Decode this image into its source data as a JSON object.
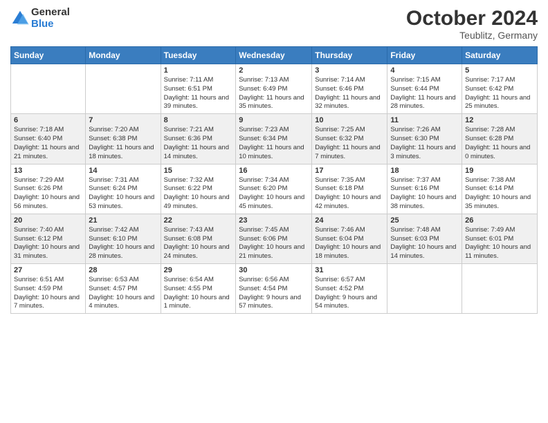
{
  "logo": {
    "general": "General",
    "blue": "Blue"
  },
  "title": "October 2024",
  "subtitle": "Teublitz, Germany",
  "days_header": [
    "Sunday",
    "Monday",
    "Tuesday",
    "Wednesday",
    "Thursday",
    "Friday",
    "Saturday"
  ],
  "weeks": [
    [
      {
        "day": "",
        "info": ""
      },
      {
        "day": "",
        "info": ""
      },
      {
        "day": "1",
        "info": "Sunrise: 7:11 AM\nSunset: 6:51 PM\nDaylight: 11 hours and 39 minutes."
      },
      {
        "day": "2",
        "info": "Sunrise: 7:13 AM\nSunset: 6:49 PM\nDaylight: 11 hours and 35 minutes."
      },
      {
        "day": "3",
        "info": "Sunrise: 7:14 AM\nSunset: 6:46 PM\nDaylight: 11 hours and 32 minutes."
      },
      {
        "day": "4",
        "info": "Sunrise: 7:15 AM\nSunset: 6:44 PM\nDaylight: 11 hours and 28 minutes."
      },
      {
        "day": "5",
        "info": "Sunrise: 7:17 AM\nSunset: 6:42 PM\nDaylight: 11 hours and 25 minutes."
      }
    ],
    [
      {
        "day": "6",
        "info": "Sunrise: 7:18 AM\nSunset: 6:40 PM\nDaylight: 11 hours and 21 minutes."
      },
      {
        "day": "7",
        "info": "Sunrise: 7:20 AM\nSunset: 6:38 PM\nDaylight: 11 hours and 18 minutes."
      },
      {
        "day": "8",
        "info": "Sunrise: 7:21 AM\nSunset: 6:36 PM\nDaylight: 11 hours and 14 minutes."
      },
      {
        "day": "9",
        "info": "Sunrise: 7:23 AM\nSunset: 6:34 PM\nDaylight: 11 hours and 10 minutes."
      },
      {
        "day": "10",
        "info": "Sunrise: 7:25 AM\nSunset: 6:32 PM\nDaylight: 11 hours and 7 minutes."
      },
      {
        "day": "11",
        "info": "Sunrise: 7:26 AM\nSunset: 6:30 PM\nDaylight: 11 hours and 3 minutes."
      },
      {
        "day": "12",
        "info": "Sunrise: 7:28 AM\nSunset: 6:28 PM\nDaylight: 11 hours and 0 minutes."
      }
    ],
    [
      {
        "day": "13",
        "info": "Sunrise: 7:29 AM\nSunset: 6:26 PM\nDaylight: 10 hours and 56 minutes."
      },
      {
        "day": "14",
        "info": "Sunrise: 7:31 AM\nSunset: 6:24 PM\nDaylight: 10 hours and 53 minutes."
      },
      {
        "day": "15",
        "info": "Sunrise: 7:32 AM\nSunset: 6:22 PM\nDaylight: 10 hours and 49 minutes."
      },
      {
        "day": "16",
        "info": "Sunrise: 7:34 AM\nSunset: 6:20 PM\nDaylight: 10 hours and 45 minutes."
      },
      {
        "day": "17",
        "info": "Sunrise: 7:35 AM\nSunset: 6:18 PM\nDaylight: 10 hours and 42 minutes."
      },
      {
        "day": "18",
        "info": "Sunrise: 7:37 AM\nSunset: 6:16 PM\nDaylight: 10 hours and 38 minutes."
      },
      {
        "day": "19",
        "info": "Sunrise: 7:38 AM\nSunset: 6:14 PM\nDaylight: 10 hours and 35 minutes."
      }
    ],
    [
      {
        "day": "20",
        "info": "Sunrise: 7:40 AM\nSunset: 6:12 PM\nDaylight: 10 hours and 31 minutes."
      },
      {
        "day": "21",
        "info": "Sunrise: 7:42 AM\nSunset: 6:10 PM\nDaylight: 10 hours and 28 minutes."
      },
      {
        "day": "22",
        "info": "Sunrise: 7:43 AM\nSunset: 6:08 PM\nDaylight: 10 hours and 24 minutes."
      },
      {
        "day": "23",
        "info": "Sunrise: 7:45 AM\nSunset: 6:06 PM\nDaylight: 10 hours and 21 minutes."
      },
      {
        "day": "24",
        "info": "Sunrise: 7:46 AM\nSunset: 6:04 PM\nDaylight: 10 hours and 18 minutes."
      },
      {
        "day": "25",
        "info": "Sunrise: 7:48 AM\nSunset: 6:03 PM\nDaylight: 10 hours and 14 minutes."
      },
      {
        "day": "26",
        "info": "Sunrise: 7:49 AM\nSunset: 6:01 PM\nDaylight: 10 hours and 11 minutes."
      }
    ],
    [
      {
        "day": "27",
        "info": "Sunrise: 6:51 AM\nSunset: 4:59 PM\nDaylight: 10 hours and 7 minutes."
      },
      {
        "day": "28",
        "info": "Sunrise: 6:53 AM\nSunset: 4:57 PM\nDaylight: 10 hours and 4 minutes."
      },
      {
        "day": "29",
        "info": "Sunrise: 6:54 AM\nSunset: 4:55 PM\nDaylight: 10 hours and 1 minute."
      },
      {
        "day": "30",
        "info": "Sunrise: 6:56 AM\nSunset: 4:54 PM\nDaylight: 9 hours and 57 minutes."
      },
      {
        "day": "31",
        "info": "Sunrise: 6:57 AM\nSunset: 4:52 PM\nDaylight: 9 hours and 54 minutes."
      },
      {
        "day": "",
        "info": ""
      },
      {
        "day": "",
        "info": ""
      }
    ]
  ]
}
